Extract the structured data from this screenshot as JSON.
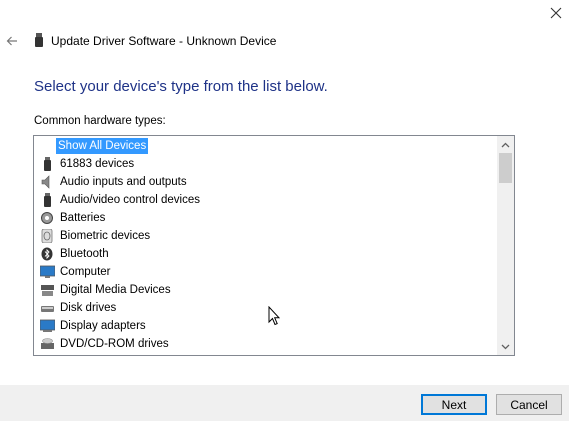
{
  "window": {
    "close_icon": "close-icon"
  },
  "header": {
    "back_icon": "back-arrow-icon",
    "device_icon": "usb-device-icon",
    "title": "Update Driver Software - Unknown Device"
  },
  "instruction": "Select your device's type from the list below.",
  "list_label": "Common hardware types:",
  "hardware_types": [
    {
      "label": "Show All Devices",
      "icon": "none",
      "selected": true
    },
    {
      "label": "61883 devices",
      "icon": "usb-icon"
    },
    {
      "label": "Audio inputs and outputs",
      "icon": "speaker-icon"
    },
    {
      "label": "Audio/video control devices",
      "icon": "usb-icon"
    },
    {
      "label": "Batteries",
      "icon": "battery-gear-icon"
    },
    {
      "label": "Biometric devices",
      "icon": "fingerprint-icon"
    },
    {
      "label": "Bluetooth",
      "icon": "bluetooth-icon"
    },
    {
      "label": "Computer",
      "icon": "monitor-icon"
    },
    {
      "label": "Digital Media Devices",
      "icon": "media-device-icon"
    },
    {
      "label": "Disk drives",
      "icon": "disk-drive-icon"
    },
    {
      "label": "Display adapters",
      "icon": "display-adapter-icon"
    },
    {
      "label": "DVD/CD-ROM drives",
      "icon": "dvd-drive-icon"
    }
  ],
  "buttons": {
    "next": "Next",
    "cancel": "Cancel"
  },
  "colors": {
    "accent": "#0078d7",
    "selection": "#3399ff",
    "instruction_text": "#1e3287",
    "footer_bg": "#f0f0f0"
  }
}
